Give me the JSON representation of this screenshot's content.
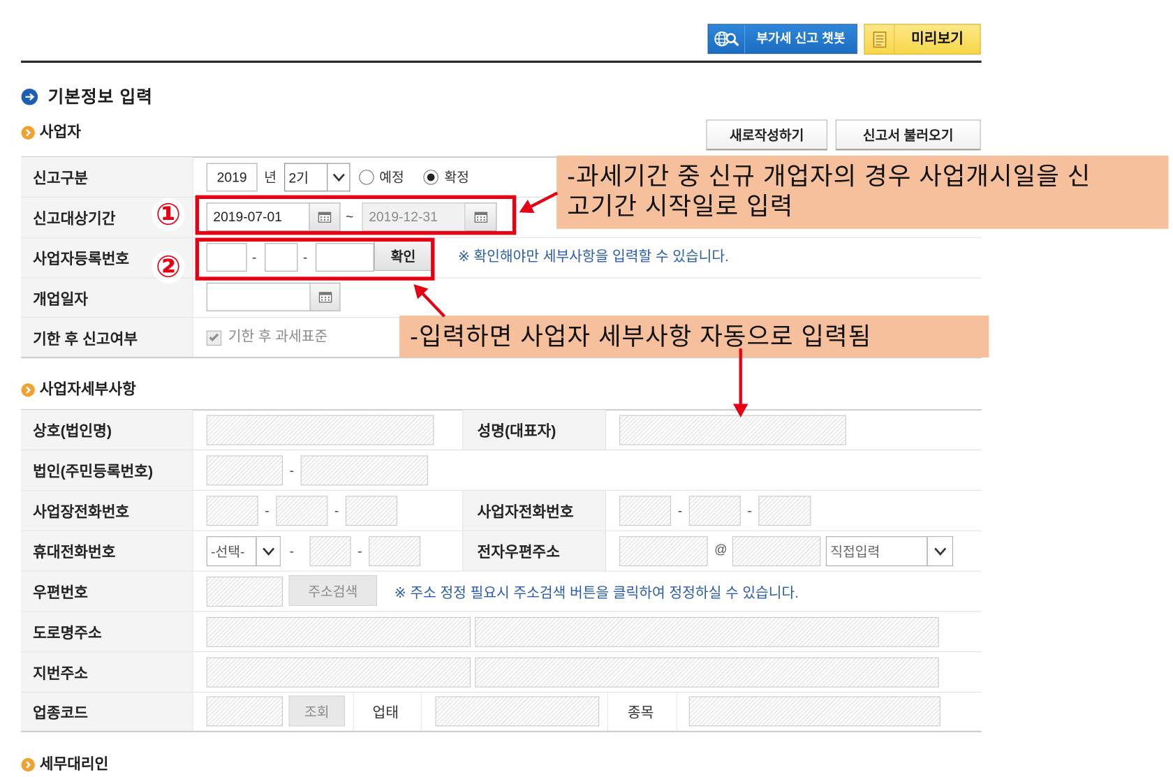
{
  "header": {
    "chatbot_label": "부가세 신고 챗봇",
    "preview_label": "미리보기"
  },
  "section_title": "기본정보 입력",
  "business": {
    "title": "사업자",
    "new_button": "새로작성하기",
    "load_button": "신고서 불러오기",
    "report_type": {
      "label": "신고구분",
      "year": "2019",
      "year_unit": "년",
      "period": "2기",
      "option_scheduled": "예정",
      "option_final": "확정",
      "scheduled_checked": false,
      "final_checked": true
    },
    "period": {
      "label": "신고대상기간",
      "start": "2019-07-01",
      "separator": "~",
      "end": "2019-12-31"
    },
    "registration": {
      "label": "사업자등록번호",
      "separator": "-",
      "confirm_button": "확인",
      "note": "※ 확인해야만 세부사항을 입력할 수 있습니다."
    },
    "open_date": {
      "label": "개업일자"
    },
    "late_filing": {
      "label": "기한 후 신고여부",
      "checkbox_label": "기한 후 과세표준",
      "checked": true
    }
  },
  "annotations": {
    "marker_1": "①",
    "marker_2": "②",
    "note_1": {
      "lines": [
        "-과세기간 중 신규 개업자의 경우 사업개시일을 신",
        "고기간 시작일로 입력"
      ]
    },
    "note_2": "-입력하면 사업자 세부사항 자동으로 입력됨"
  },
  "details": {
    "title": "사업자세부사항",
    "trade_name": "상호(법인명)",
    "representative": "성명(대표자)",
    "corp_id": "법인(주민등록번호)",
    "biz_phone": "사업장전화번호",
    "owner_phone": "사업자전화번호",
    "mobile": "휴대전화번호",
    "mobile_prefix": "-선택-",
    "email": "전자우편주소",
    "email_at": "@",
    "email_domain": "직접입력",
    "postcode": "우편번호",
    "address_search": "주소검색",
    "address_note": "※ 주소 정정 필요시 주소검색 버튼을 클릭하여 정정하실 수 있습니다.",
    "road_address": "도로명주소",
    "lot_address": "지번주소",
    "industry_code": "업종코드",
    "lookup_button": "조회",
    "business_type": "업태",
    "business_item": "종목",
    "separator": "-"
  },
  "tax_agent": {
    "title": "세무대리인"
  },
  "icons": {
    "chatbot": "globe-search-icon",
    "preview": "document-icon",
    "section": "arrow-circle-icon",
    "subsection": "chevron-circle-icon",
    "date_picker": "calendar-icon",
    "select": "chevron-down-icon"
  },
  "colors": {
    "accent_blue": "#1b6ec2",
    "preview_yellow": "#f8d649",
    "annotation_bg": "#f5c09b",
    "highlight_red": "#e60012",
    "note_blue": "#2a5cab"
  }
}
